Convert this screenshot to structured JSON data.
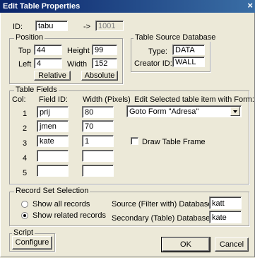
{
  "window": {
    "title": "Edit Table Properties",
    "close_glyph": "×"
  },
  "id_row": {
    "label": "ID:",
    "value": "tabu",
    "arrow": "->",
    "numeric_id": "1001"
  },
  "position": {
    "group_label": "Position",
    "top_label": "Top",
    "top_value": "44",
    "height_label": "Height",
    "height_value": "99",
    "left_label": "Left",
    "left_value": "4",
    "width_label": "Width",
    "width_value": "152",
    "relative_label": "Relative",
    "absolute_label": "Absolute"
  },
  "source_db": {
    "group_label": "Table Source Database",
    "type_label": "Type:",
    "type_value": "DATA",
    "creator_label": "Creator ID:",
    "creator_value": "WALL"
  },
  "fields": {
    "group_label": "Table Fields",
    "col_header": "Col:",
    "field_header": "Field ID:",
    "width_header": "Width (Pixels)",
    "edit_header": "Edit  Selected table item with Form:",
    "form_select": "Goto Form \"Adresa\"",
    "draw_frame_label": "Draw Table Frame",
    "rows": [
      {
        "col": "1",
        "field": "prij",
        "width": "80"
      },
      {
        "col": "2",
        "field": "jmen",
        "width": "70"
      },
      {
        "col": "3",
        "field": "kate",
        "width": "1"
      },
      {
        "col": "4",
        "field": "",
        "width": ""
      },
      {
        "col": "5",
        "field": "",
        "width": ""
      }
    ]
  },
  "recordset": {
    "group_label": "Record Set Selection",
    "show_all_label": "Show all records",
    "show_related_label": "Show related records",
    "selected": "show_related",
    "source_label": "Source (Filter with) Database Field:",
    "source_value": "katt",
    "secondary_label": "Secondary (Table) Database Field:",
    "secondary_value": "kate"
  },
  "script": {
    "group_label": "Script",
    "configure_label": "Configure"
  },
  "buttons": {
    "ok_label": "OK",
    "cancel_label": "Cancel"
  }
}
